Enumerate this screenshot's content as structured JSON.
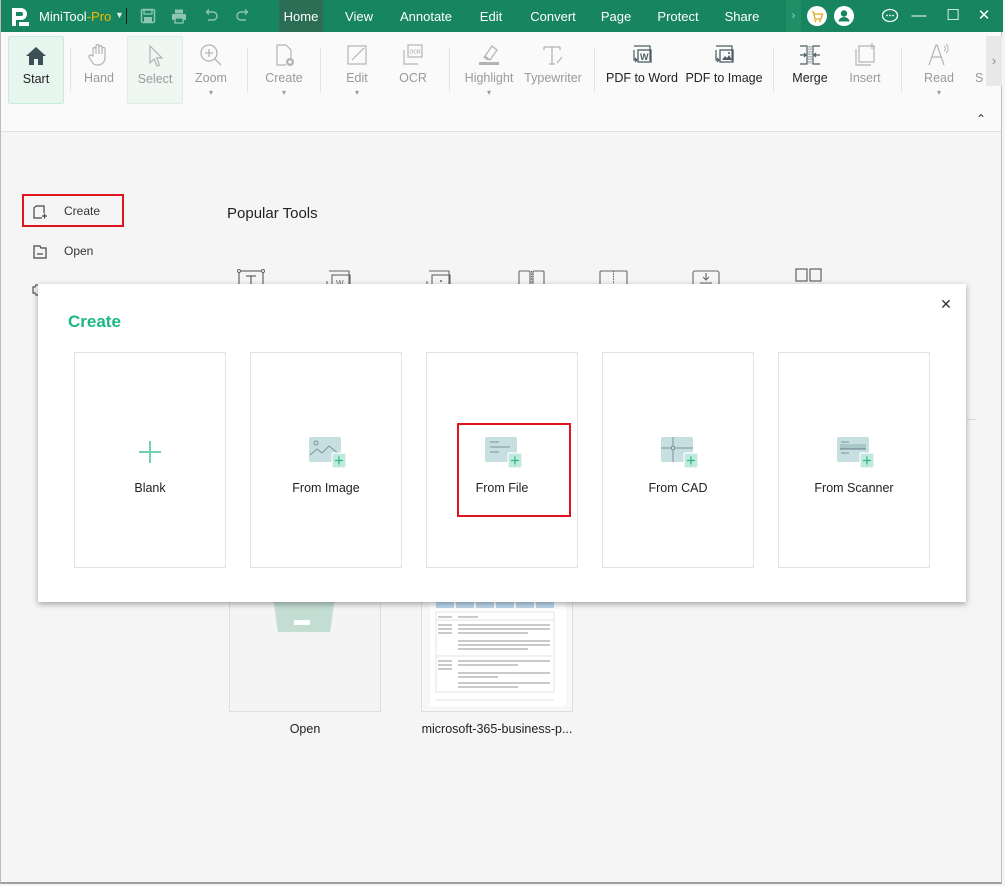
{
  "titlebar": {
    "app_name": "MiniTool",
    "app_suffix": "-Pro",
    "menu_tabs": [
      {
        "label": "Home",
        "active": true
      },
      {
        "label": "View",
        "active": false
      },
      {
        "label": "Annotate",
        "active": false
      },
      {
        "label": "Edit",
        "active": false
      },
      {
        "label": "Convert",
        "active": false
      },
      {
        "label": "Page",
        "active": false
      },
      {
        "label": "Protect",
        "active": false
      },
      {
        "label": "Share",
        "active": false
      }
    ],
    "more_tabs_glyph": "›",
    "window_controls": {
      "minimize": "—",
      "maximize": "☐",
      "close": "✕"
    }
  },
  "ribbon": {
    "buttons": [
      {
        "label": "Start",
        "icon": "home-icon",
        "enabled": true
      },
      {
        "label": "Hand",
        "icon": "hand-icon",
        "enabled": false
      },
      {
        "label": "Select",
        "icon": "cursor-icon",
        "enabled": false
      },
      {
        "label": "Zoom",
        "icon": "zoom-icon",
        "enabled": false,
        "dropdown": true
      },
      {
        "label": "Create",
        "icon": "create-file-icon",
        "enabled": false,
        "dropdown": true
      },
      {
        "label": "Edit",
        "icon": "edit-icon",
        "enabled": false,
        "dropdown": true
      },
      {
        "label": "OCR",
        "icon": "ocr-icon",
        "enabled": false
      },
      {
        "label": "Highlight",
        "icon": "highlight-icon",
        "enabled": false,
        "dropdown": true
      },
      {
        "label": "Typewriter",
        "icon": "typewriter-icon",
        "enabled": false
      },
      {
        "label": "PDF to Word",
        "icon": "pdf-to-word-icon",
        "enabled": true
      },
      {
        "label": "PDF to Image",
        "icon": "pdf-to-image-icon",
        "enabled": true
      },
      {
        "label": "Merge",
        "icon": "merge-icon",
        "enabled": true
      },
      {
        "label": "Insert",
        "icon": "insert-icon",
        "enabled": false
      },
      {
        "label": "Read",
        "icon": "read-aloud-icon",
        "enabled": false,
        "dropdown": true
      },
      {
        "label": "S",
        "icon": "",
        "enabled": false
      }
    ],
    "dropdown_glyph": "▾",
    "scroll_glyph": "›",
    "collapse_glyph": "⌃"
  },
  "home": {
    "sidebar": [
      {
        "label": "Create",
        "icon": "create-icon"
      },
      {
        "label": "Open",
        "icon": "open-folder-icon"
      }
    ],
    "popular_tools_title": "Popular Tools",
    "recent": [
      {
        "label": "Open"
      },
      {
        "label": "microsoft-365-business-p..."
      }
    ]
  },
  "dialog": {
    "title": "Create",
    "close_glyph": "✕",
    "options": [
      {
        "label": "Blank",
        "icon": "plus-icon"
      },
      {
        "label": "From Image",
        "icon": "image-add-icon"
      },
      {
        "label": "From File",
        "icon": "file-add-icon"
      },
      {
        "label": "From CAD",
        "icon": "cad-add-icon"
      },
      {
        "label": "From Scanner",
        "icon": "scanner-add-icon"
      }
    ]
  },
  "colors": {
    "brand_green": "#17855f",
    "accent_mint": "#1bb884",
    "highlight_red": "#e0141e",
    "pro_gold": "#f5b800"
  }
}
